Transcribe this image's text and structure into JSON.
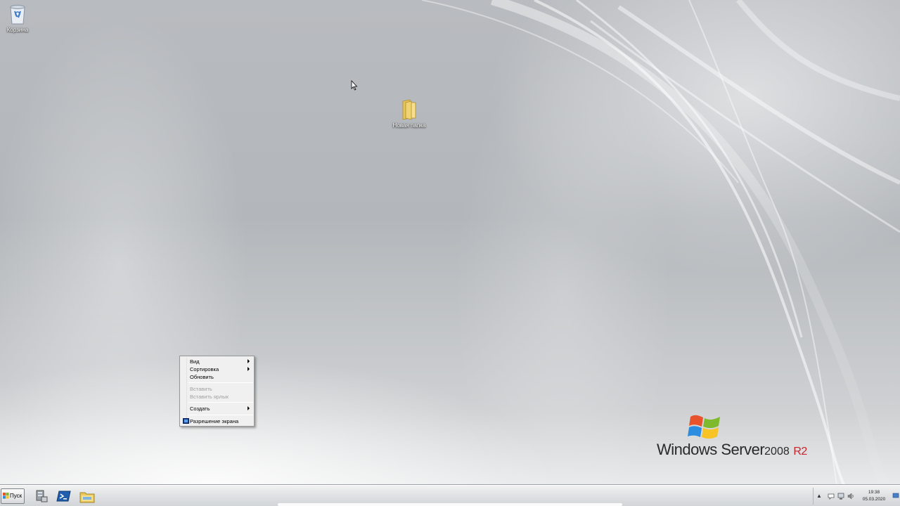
{
  "desktop": {
    "icons": [
      {
        "label": "Корзина",
        "icon": "recycle-bin-icon"
      },
      {
        "label": "Новая папка",
        "icon": "folder-icon"
      }
    ],
    "branding": {
      "product": "Windows Server",
      "version": "2008",
      "edition": "R2"
    }
  },
  "context_menu": {
    "items": [
      {
        "label": "Вид",
        "submenu": true,
        "enabled": true
      },
      {
        "label": "Сортировка",
        "submenu": true,
        "enabled": true
      },
      {
        "label": "Обновить",
        "submenu": false,
        "enabled": true
      },
      {
        "label": "Вставить",
        "submenu": false,
        "enabled": false
      },
      {
        "label": "Вставить ярлык",
        "submenu": false,
        "enabled": false
      },
      {
        "label": "Создать",
        "submenu": true,
        "enabled": true
      },
      {
        "label": "Разрешение экрана",
        "submenu": false,
        "enabled": true,
        "icon": "display-icon"
      }
    ]
  },
  "taskbar": {
    "start_label": "Пуск",
    "pinned": [
      {
        "icon": "server-manager-icon"
      },
      {
        "icon": "powershell-icon"
      },
      {
        "icon": "explorer-folder-icon"
      }
    ],
    "tray": {
      "icons": [
        "show-hidden-icons-chevron",
        "action-center-icon",
        "network-icon",
        "volume-icon"
      ],
      "time": "19:38",
      "date": "05.03.2020"
    }
  },
  "colors": {
    "accent_red": "#c8242b",
    "taskbar": "#dfe1e3"
  }
}
